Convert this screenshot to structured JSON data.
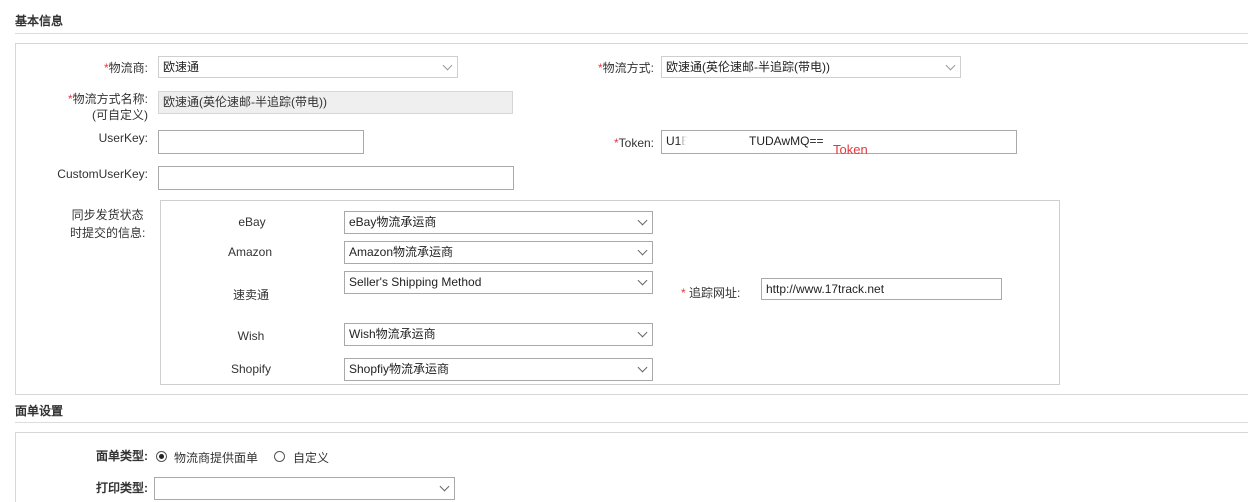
{
  "basic_info": {
    "title": "基本信息",
    "carrier": {
      "label": "物流商:",
      "value": "欧速通"
    },
    "method": {
      "label": "物流方式:",
      "value": "欧速通(英伦速邮-半追踪(带电))"
    },
    "method_name": {
      "label_line1": "物流方式名称:",
      "label_line2": "(可自定义)",
      "value": "欧速通(英伦速邮-半追踪(带电))"
    },
    "userkey": {
      "label": "UserKey:",
      "value": ""
    },
    "token": {
      "label": "Token:",
      "value_start": "U1B",
      "value_end": "TUDAwMQ==",
      "annotation": "Token"
    },
    "custom_userkey": {
      "label": "CustomUserKey:",
      "value": ""
    },
    "sync": {
      "label_line1": "同步发货状态",
      "label_line2": "时提交的信息:",
      "rows": [
        {
          "platform": "eBay",
          "value": "eBay物流承运商"
        },
        {
          "platform": "Amazon",
          "value": "Amazon物流承运商"
        },
        {
          "platform": "速卖通",
          "value": "Seller's Shipping Method"
        },
        {
          "platform": "Wish",
          "value": "Wish物流承运商"
        },
        {
          "platform": "Shopify",
          "value": "Shopfiy物流承运商"
        }
      ],
      "tracking": {
        "label": "追踪网址:",
        "value": "http://www.17track.net"
      }
    }
  },
  "label_settings": {
    "title": "面单设置",
    "label_type": {
      "label": "面单类型:",
      "options": [
        "物流商提供面单",
        "自定义"
      ],
      "selected": 0
    },
    "print_type": {
      "label": "打印类型:",
      "value": ""
    }
  },
  "required_mark": "*"
}
